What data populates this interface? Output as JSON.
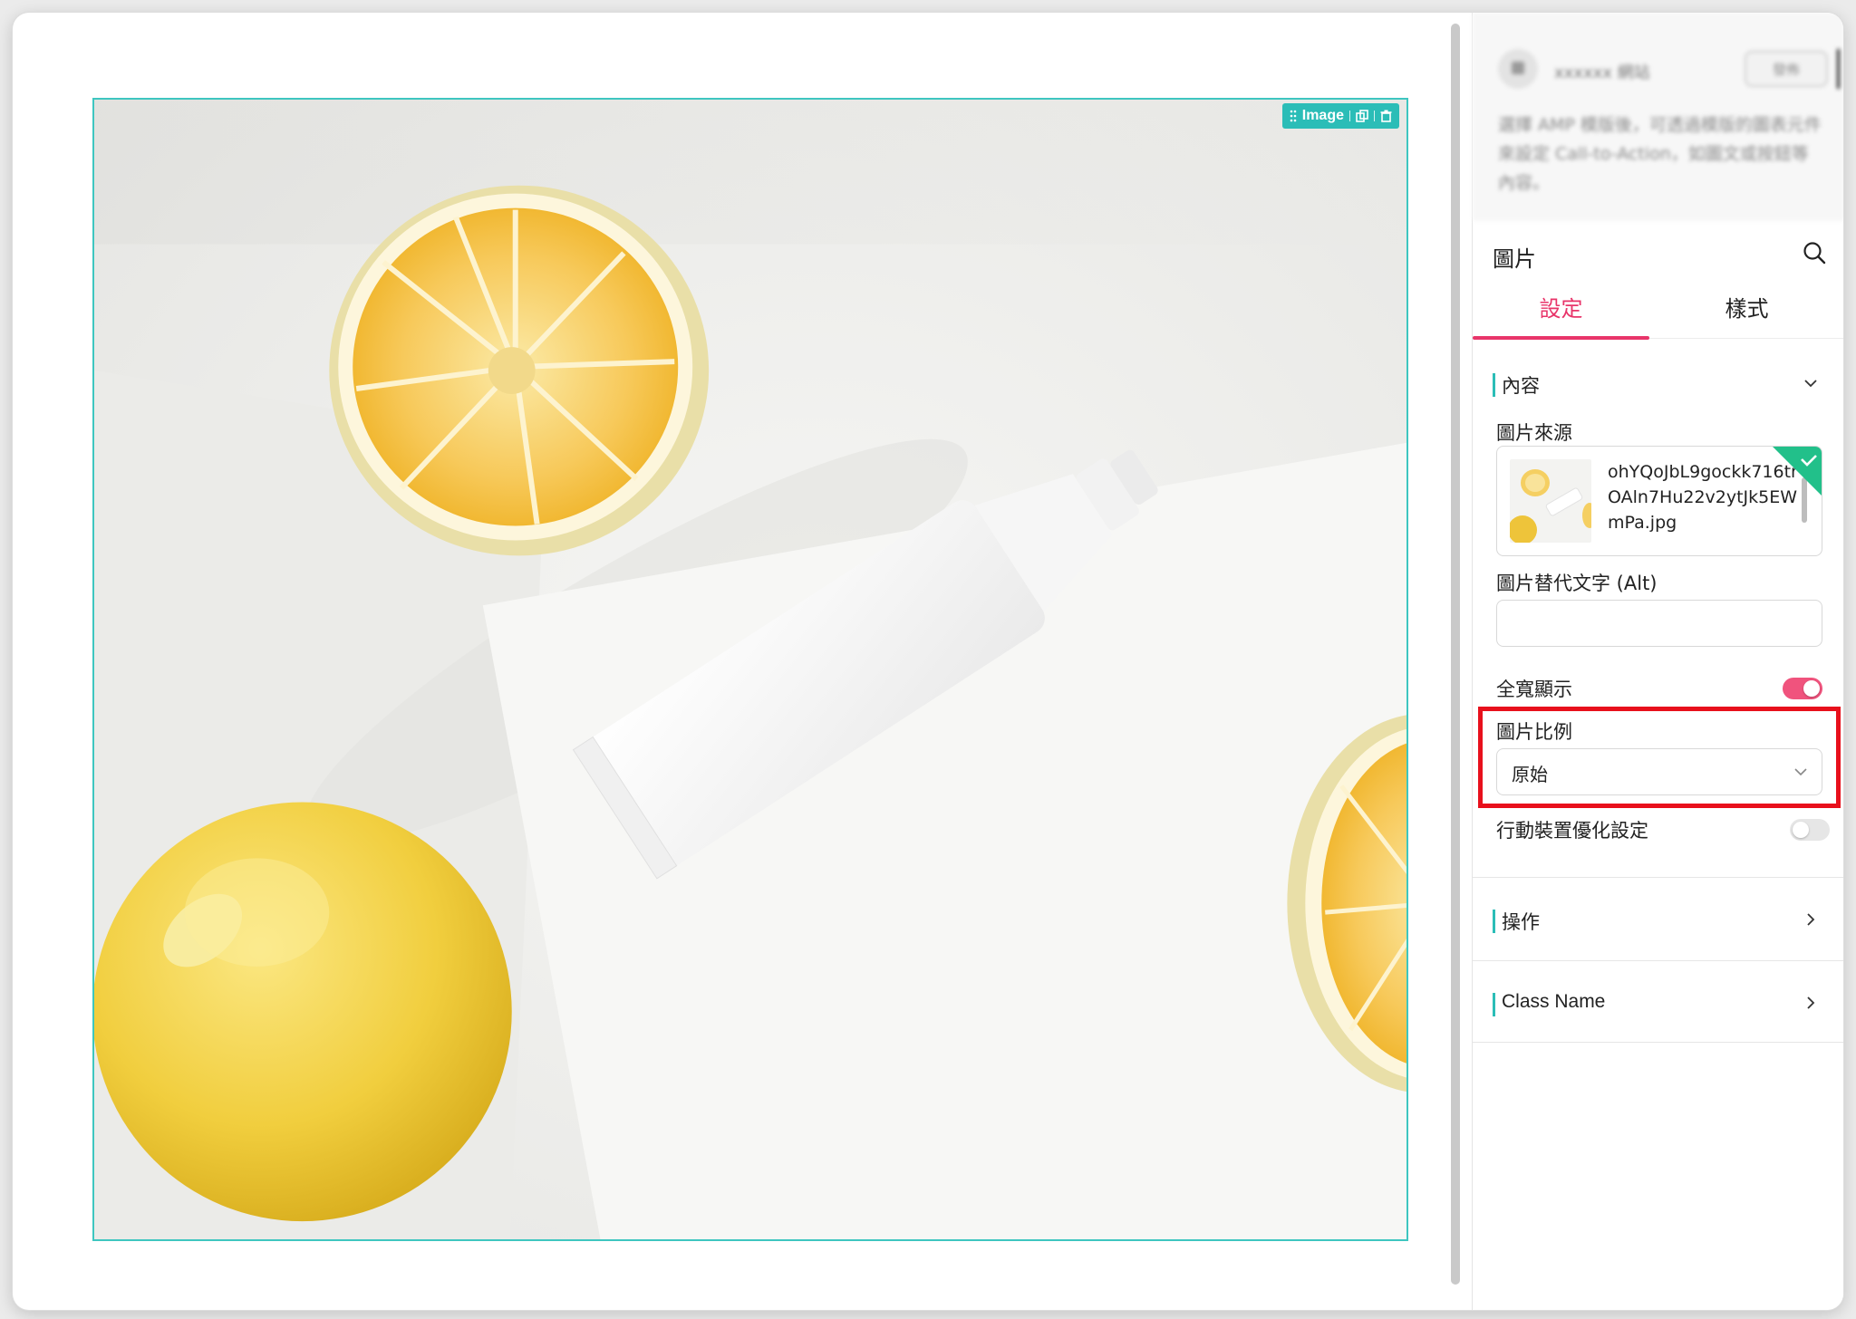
{
  "canvas": {
    "image_block": {
      "toolbar_label": "Image"
    }
  },
  "panel": {
    "header": {
      "name": "xxxxxx 網站",
      "button_label": "發佈",
      "description": "選擇 AMP 模版後，可透過模版的圖表元件來設定 Call-to-Action，如圖文或按鈕等內容。"
    },
    "section_title": "圖片",
    "tabs": [
      {
        "label": "設定",
        "active": true
      },
      {
        "label": "樣式",
        "active": false
      }
    ],
    "content_group": {
      "title": "內容",
      "image_source": {
        "label": "圖片來源",
        "file_name": "ohYQoJbL9gockk716trOAln7Hu22v2ytJk5EWmPa.jpg"
      },
      "alt_text": {
        "label": "圖片替代文字 (Alt)",
        "value": ""
      },
      "full_width": {
        "label": "全寬顯示",
        "enabled": true
      },
      "aspect_ratio": {
        "label": "圖片比例",
        "value": "原始"
      },
      "mobile_optimize": {
        "label": "行動裝置優化設定",
        "enabled": false
      }
    },
    "action_group": {
      "title": "操作"
    },
    "classname_group": {
      "title": "Class Name"
    }
  },
  "colors": {
    "accent_pink": "#e8356a",
    "teal": "#2bbdb7",
    "highlight_red": "#e8101c"
  },
  "icons": [
    "drag-handle-icon",
    "duplicate-icon",
    "trash-icon",
    "search-icon",
    "chevron-down-icon",
    "chevron-right-icon",
    "check-icon"
  ]
}
